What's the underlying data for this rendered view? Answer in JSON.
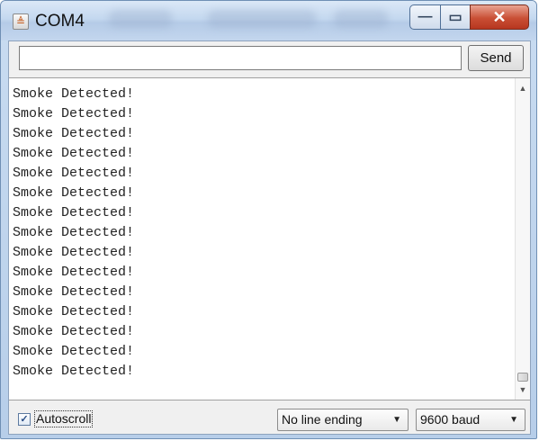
{
  "window": {
    "title": "COM4",
    "app_icon_glyph": "≜",
    "minimize_glyph": "—",
    "maximize_glyph": "▭",
    "close_glyph": "✕"
  },
  "send": {
    "input_value": "",
    "input_placeholder": "",
    "button_label": "Send"
  },
  "output": {
    "lines": [
      "Smoke Detected!",
      "Smoke Detected!",
      "Smoke Detected!",
      "Smoke Detected!",
      "Smoke Detected!",
      "Smoke Detected!",
      "Smoke Detected!",
      "Smoke Detected!",
      "Smoke Detected!",
      "Smoke Detected!",
      "Smoke Detected!",
      "Smoke Detected!",
      "Smoke Detected!",
      "Smoke Detected!",
      "Smoke Detected!"
    ]
  },
  "footer": {
    "autoscroll_label": "Autoscroll",
    "autoscroll_checked": true,
    "line_ending_selected": "No line ending",
    "baud_selected": "9600 baud"
  },
  "colors": {
    "title_bar": "#c4d8ef",
    "close_button": "#c94f35",
    "client_bg": "#f0f0f0"
  }
}
